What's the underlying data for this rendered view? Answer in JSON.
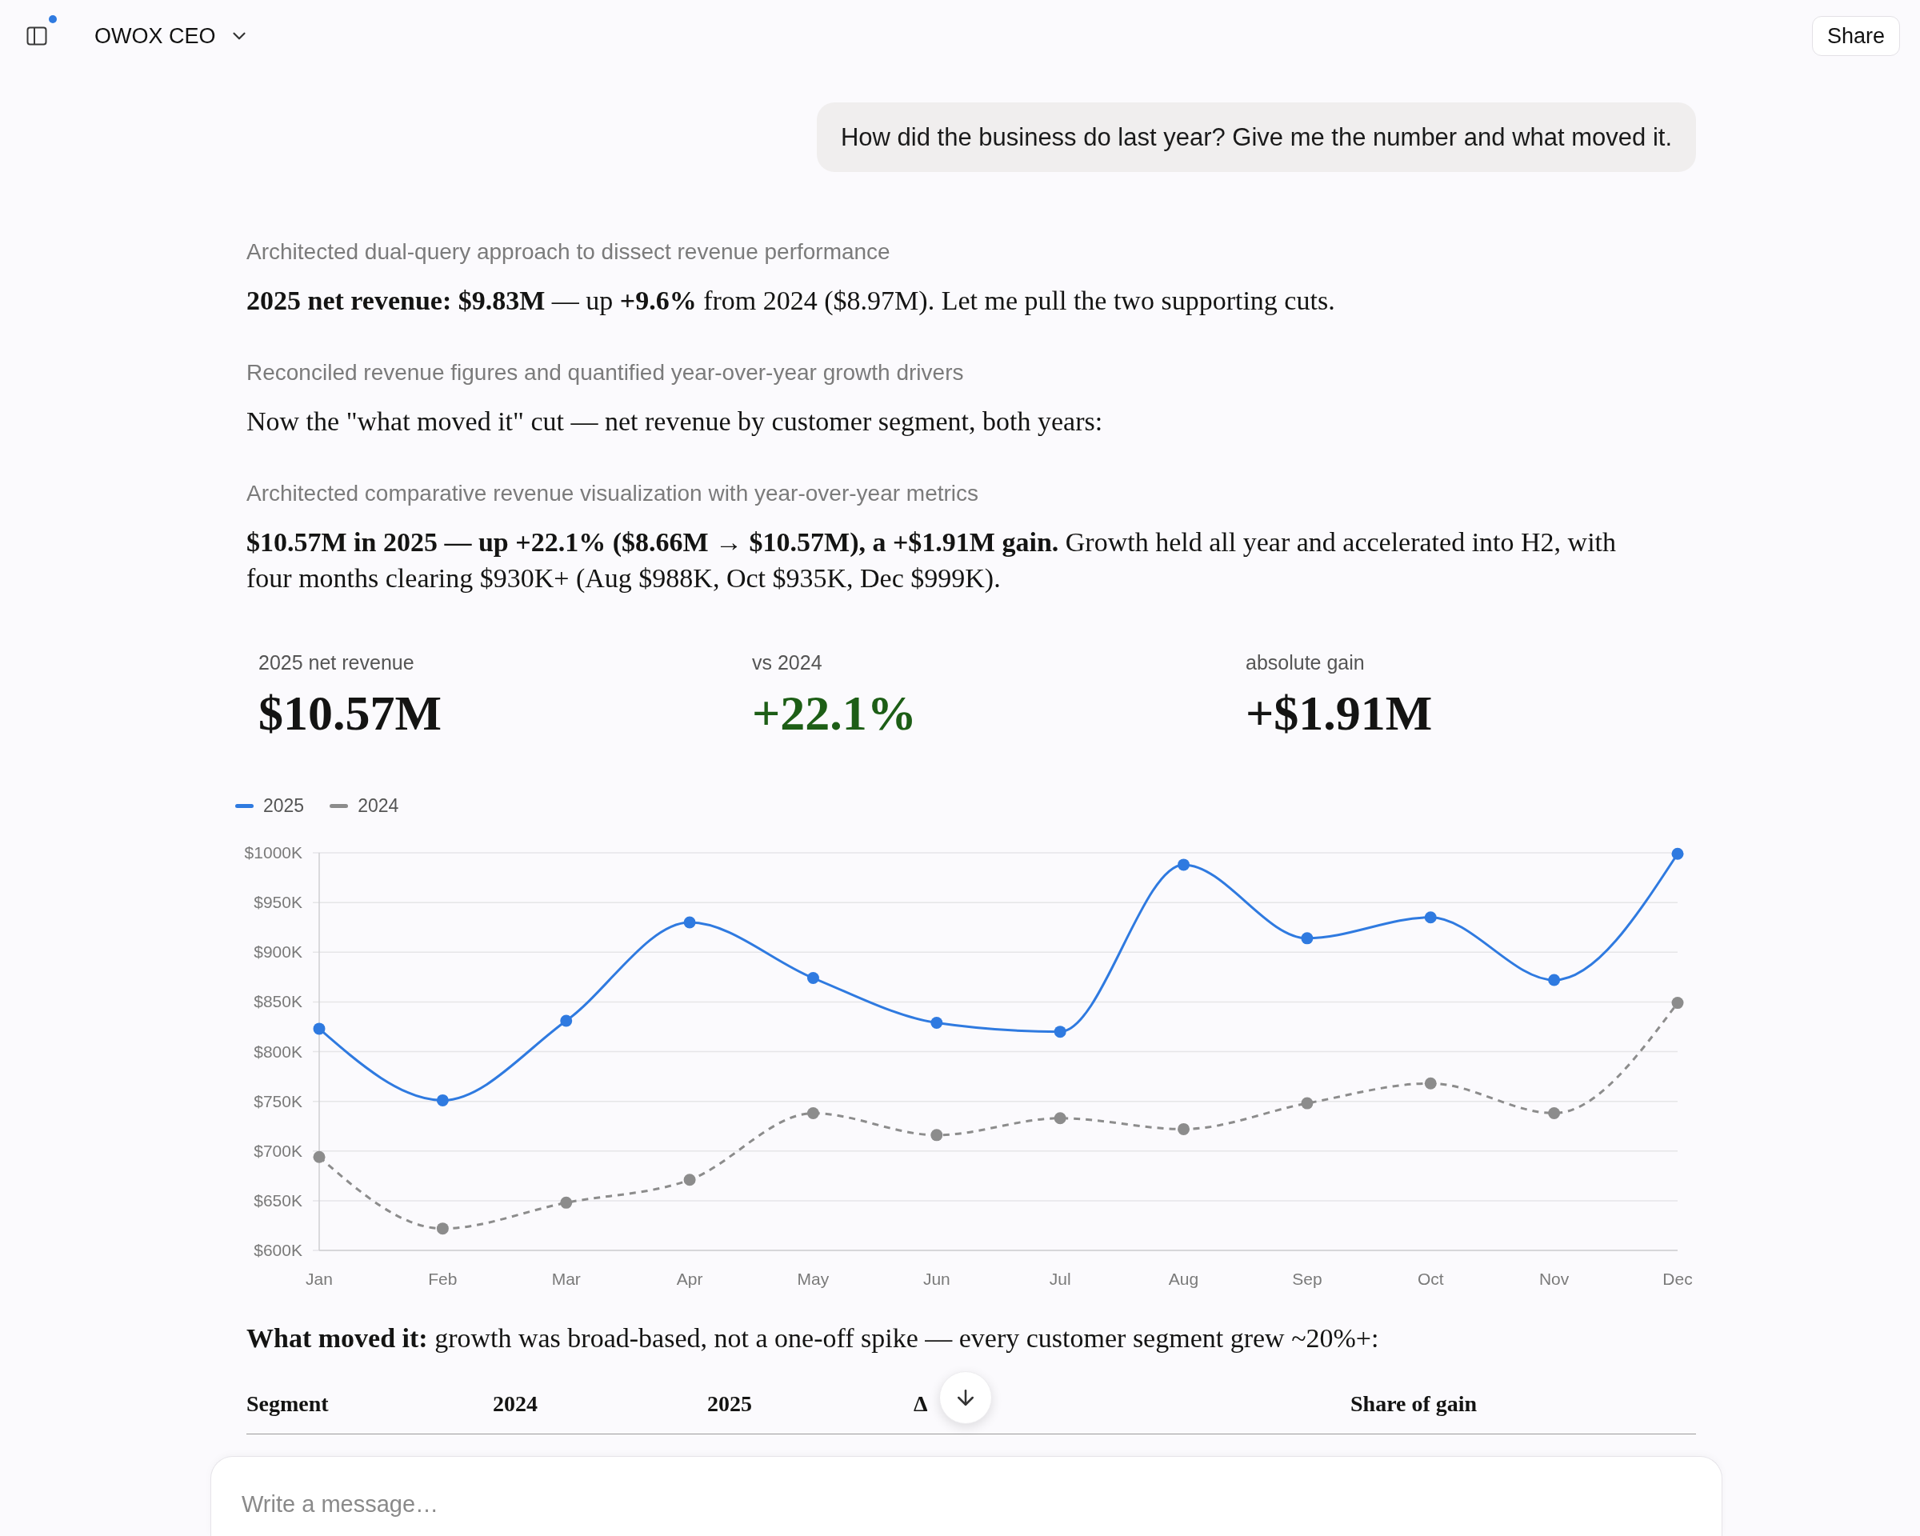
{
  "top_bar": {
    "workspace": "OWOX CEO",
    "share_button": "Share"
  },
  "user_message": "How did the business do last year? Give me the number and what moved it.",
  "response": [
    {
      "kind": "thinking",
      "text": "Architected dual-query approach to dissect revenue performance"
    },
    {
      "kind": "paragraph",
      "text": "**2025 net revenue: $9.83M** — up **+9.6%** from 2024 ($8.97M). Let me pull the two supporting cuts."
    },
    {
      "kind": "thinking",
      "text": "Reconciled revenue figures and quantified year-over-year growth drivers"
    },
    {
      "kind": "paragraph",
      "text": "Now the \"what moved it\" cut — net revenue by customer segment, both years:"
    },
    {
      "kind": "thinking",
      "text": "Architected comparative revenue visualization with year-over-year metrics"
    },
    {
      "kind": "paragraph",
      "text": "**$10.57M in 2025 — up +22.1% ($8.66M → $10.57M), a +$1.91M gain.** Growth held all year and accelerated into H2, with four months clearing $930K+ (Aug $988K, Oct $935K, Dec $999K)."
    },
    {
      "kind": "kpis",
      "items": [
        {
          "label": "2025 net revenue",
          "value": "$10.57M",
          "color": "#141413"
        },
        {
          "label": "vs 2024",
          "value": "+22.1%",
          "color": "#1d5e16"
        },
        {
          "label": "absolute gain",
          "value": "+$1.91M",
          "color": "#141413"
        }
      ]
    },
    {
      "kind": "chart",
      "chart_data": {
        "type": "line",
        "grid": true,
        "legend": "top-left",
        "categories": [
          "Jan",
          "Feb",
          "Mar",
          "Apr",
          "May",
          "Jun",
          "Jul",
          "Aug",
          "Sep",
          "Oct",
          "Nov",
          "Dec"
        ],
        "series": [
          {
            "name": "2025",
            "color": "#2f7ae0",
            "line_style": "solid",
            "marker": "circle",
            "values": [
              823,
              751,
              831,
              930,
              874,
              829,
              820,
              988,
              914,
              935,
              872,
              999
            ]
          },
          {
            "name": "2024",
            "color": "#8c8c8c",
            "line_style": "dashed",
            "marker": "circle",
            "values": [
              694,
              622,
              648,
              671,
              738,
              716,
              733,
              722,
              748,
              768,
              738,
              849
            ]
          }
        ],
        "ylim": [
          600,
          1000
        ],
        "yticks": [
          {
            "value": 600,
            "label": "$600K"
          },
          {
            "value": 650,
            "label": "$650K"
          },
          {
            "value": 700,
            "label": "$700K"
          },
          {
            "value": 750,
            "label": "$750K"
          },
          {
            "value": 800,
            "label": "$800K"
          },
          {
            "value": 850,
            "label": "$850K"
          },
          {
            "value": 900,
            "label": "$900K"
          },
          {
            "value": 950,
            "label": "$950K"
          },
          {
            "value": 1000,
            "label": "$1000K"
          }
        ]
      }
    },
    {
      "kind": "paragraph",
      "text": "**What moved it:** growth was broad-based, not a one-off spike — every customer segment grew ~20%+:"
    },
    {
      "kind": "table",
      "columns": [
        "Segment",
        "2024",
        "2025",
        "Δ",
        "Share of gain"
      ]
    }
  ],
  "composer": {
    "placeholder": "Write a message…"
  }
}
